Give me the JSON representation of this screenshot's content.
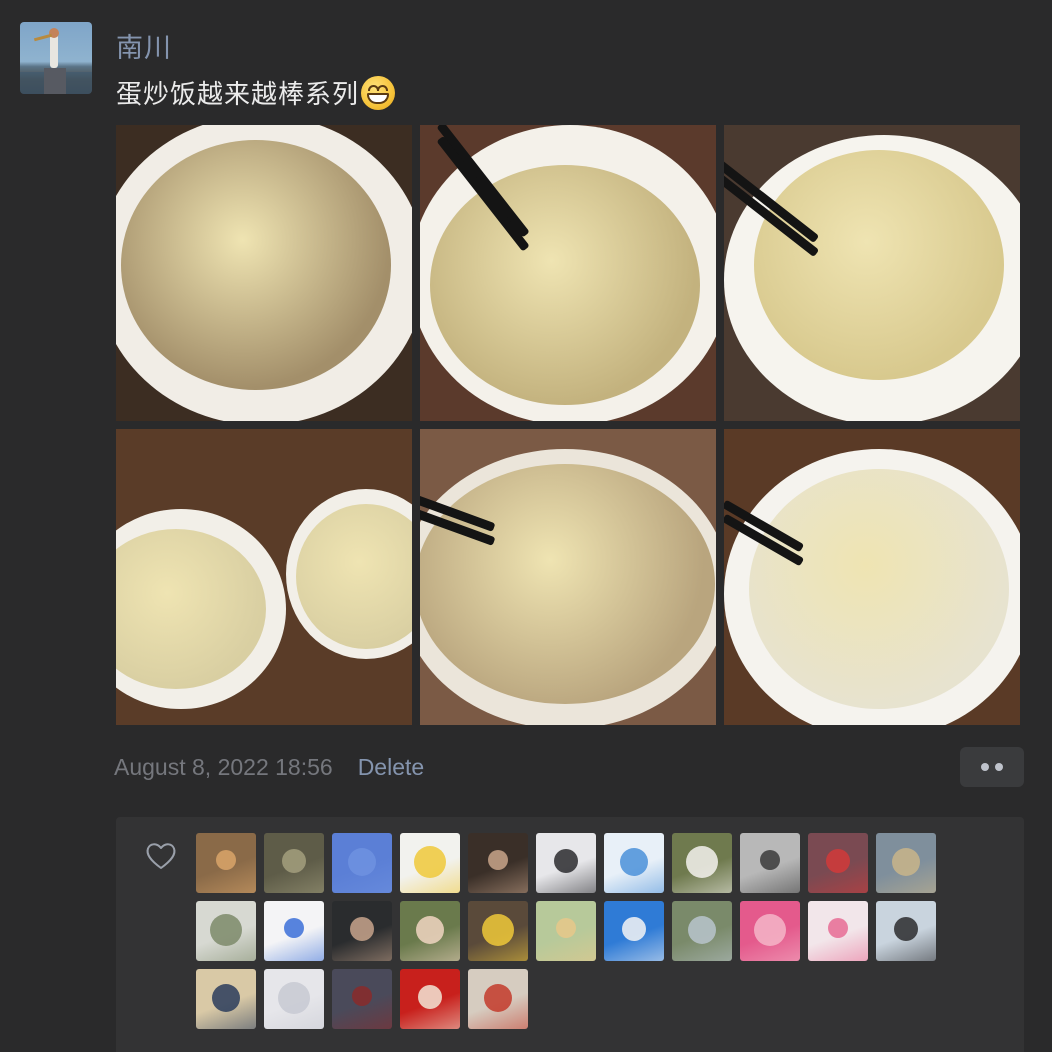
{
  "post": {
    "username": "南川",
    "caption": "蛋炒饭越来越棒系列",
    "caption_emoji": "grinning-face-emoji",
    "timestamp": "August 8, 2022 18:56",
    "delete_label": "Delete",
    "more_icon": "more-dots-icon"
  },
  "photos": [
    {
      "name": "photo-fried-rice-1",
      "bg": "#3c2d22",
      "bowl": "#f1ede6",
      "rice": "#a38f6a"
    },
    {
      "name": "photo-fried-rice-2",
      "bg": "#5b3a2c",
      "bowl": "#f4f1ea",
      "rice": "#c3b27e"
    },
    {
      "name": "photo-fried-rice-3",
      "bg": "#4a3a30",
      "bowl": "#f6f4ee",
      "rice": "#d8c98e"
    },
    {
      "name": "photo-fried-rice-4",
      "bg": "#5a3c28",
      "bowl": "#f2efe8",
      "rice": "#d9cfa2"
    },
    {
      "name": "photo-fried-rice-5",
      "bg": "#7b5a45",
      "bowl": "#ebe5da",
      "rice": "#b9a57e"
    },
    {
      "name": "photo-fried-rice-6",
      "bg": "#5a3a26",
      "bowl": "#f5f3ee",
      "rice": "#e7e3cf"
    }
  ],
  "likes": {
    "heart_icon": "heart-outline-icon",
    "likers": [
      {
        "name": "liker-avatar-shiba",
        "bg": "#8a6a48",
        "accent": "#d9a56a"
      },
      {
        "name": "liker-avatar-forest",
        "bg": "#5e5c48",
        "accent": "#a39f7e"
      },
      {
        "name": "liker-avatar-blue-sky",
        "bg": "#5b7fd6",
        "accent": "#6f92e0"
      },
      {
        "name": "liker-avatar-cartoon-smile",
        "bg": "#f2f2ee",
        "accent": "#f0c93a"
      },
      {
        "name": "liker-avatar-old-man",
        "bg": "#3a2f28",
        "accent": "#c9a58a"
      },
      {
        "name": "liker-avatar-portrait-woman",
        "bg": "#e7e7ea",
        "accent": "#2a2a2e"
      },
      {
        "name": "liker-avatar-doraemon",
        "bg": "#e8f0f8",
        "accent": "#4a90d9"
      },
      {
        "name": "liker-avatar-white-dog",
        "bg": "#6f7a4e",
        "accent": "#f4f2ee"
      },
      {
        "name": "liker-avatar-bw-woman",
        "bg": "#b8b8b8",
        "accent": "#3a3a3a"
      },
      {
        "name": "liker-avatar-santa-girl",
        "bg": "#7a4a52",
        "accent": "#d23a3a"
      },
      {
        "name": "liker-avatar-beach",
        "bg": "#7f8f9c",
        "accent": "#c9b58a"
      },
      {
        "name": "liker-avatar-geese",
        "bg": "#d7d9d2",
        "accent": "#7d8a6a"
      },
      {
        "name": "liker-avatar-blue-blob",
        "bg": "#f4f4f6",
        "accent": "#3b6fd8"
      },
      {
        "name": "liker-avatar-woman-dark",
        "bg": "#2a2c2e",
        "accent": "#c8a58c"
      },
      {
        "name": "liker-avatar-smiling-woman",
        "bg": "#6a7a4c",
        "accent": "#f1d6c2"
      },
      {
        "name": "liker-avatar-boy-yellow",
        "bg": "#5a4a3a",
        "accent": "#f0c93a"
      },
      {
        "name": "liker-avatar-child-park",
        "bg": "#b7c99a",
        "accent": "#e8c88a"
      },
      {
        "name": "liker-avatar-dragon-cartoon",
        "bg": "#2f7bd6",
        "accent": "#f4f4f4"
      },
      {
        "name": "liker-avatar-field",
        "bg": "#7a8a6a",
        "accent": "#b9c4cc"
      },
      {
        "name": "liker-avatar-pink-hat",
        "bg": "#e45a8c",
        "accent": "#f4b6c8"
      },
      {
        "name": "liker-avatar-anime-pink",
        "bg": "#f2e6ea",
        "accent": "#e86b94"
      },
      {
        "name": "liker-avatar-girl-bob",
        "bg": "#c9d4de",
        "accent": "#2b2b2e"
      },
      {
        "name": "liker-avatar-sunglasses",
        "bg": "#d9c9a6",
        "accent": "#2a3c5c"
      },
      {
        "name": "liker-avatar-ballet-girl",
        "bg": "#e6e6ea",
        "accent": "#c7c9d2"
      },
      {
        "name": "liker-avatar-basketball-kid",
        "bg": "#4a4a5a",
        "accent": "#8a2a2a"
      },
      {
        "name": "liker-avatar-red-art",
        "bg": "#c8201c",
        "accent": "#f2e6d6"
      },
      {
        "name": "liker-avatar-toddler",
        "bg": "#d6ccc0",
        "accent": "#c33a2a"
      }
    ]
  }
}
